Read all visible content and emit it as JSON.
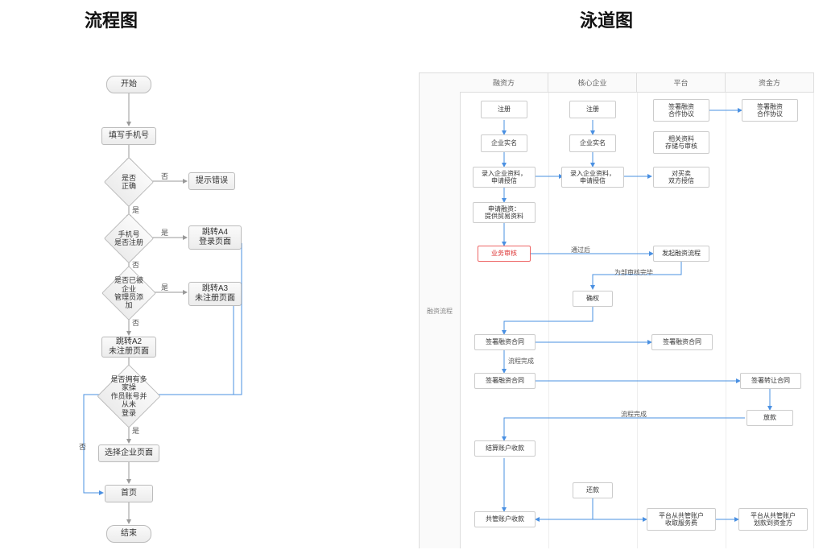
{
  "titles": {
    "flowchart": "流程图",
    "swimlane": "泳道图"
  },
  "flowchart": {
    "start": "开始",
    "phone": "填写手机号",
    "d_correct": "是否\n正确",
    "tip_error": "提示错误",
    "d_registered": "手机号\n是否注册",
    "a4": "跳转A4\n登录页面",
    "d_added": "是否已被企业\n管理员添加",
    "a3": "跳转A3\n未注册页面",
    "a2": "跳转A2\n未注册页面",
    "d_multi": "是否拥有多家操\n作员账号并从未\n登录",
    "select": "选择企业页面",
    "home": "首页",
    "end": "结束",
    "yes": "是",
    "no": "否"
  },
  "swimlane": {
    "side": "融资流程",
    "lanes": [
      "融资方",
      "核心企业",
      "平台",
      "资金方"
    ],
    "r1": {
      "c1": "注册",
      "c2": "注册",
      "c3": "签署融资\n合作协议",
      "c4": "签署融资\n合作协议"
    },
    "r2": {
      "c1": "企业实名",
      "c2": "企业实名",
      "c3": "相关资料\n存储与审核"
    },
    "r3": {
      "c1": "录入企业资料，\n申请授信",
      "c2": "录入企业资料，\n申请授信",
      "c3": "对买卖\n双方授信"
    },
    "r4": {
      "c1": "申请融资：\n提供贸易资料"
    },
    "r5": {
      "c1": "业务审核",
      "c3": "发起融资流程",
      "edge": "通过后",
      "edge2": "为部审核完毕"
    },
    "r6": {
      "c2": "确权"
    },
    "r7": {
      "c1": "签署融资合同",
      "c3": "签署融资合同",
      "edge": "流程完成"
    },
    "r8": {
      "c1": "签署融资合同",
      "c4": "签署转让合同"
    },
    "r9": {
      "c4": "放款",
      "edge": "流程完成"
    },
    "r10": {
      "c1": "结算账户收款"
    },
    "r11": {
      "c2": "还款"
    },
    "r12": {
      "c1": "共管账户收款",
      "c3": "平台从共管账户\n收取服务费",
      "c4": "平台从共管账户\n划款到资金方"
    }
  }
}
